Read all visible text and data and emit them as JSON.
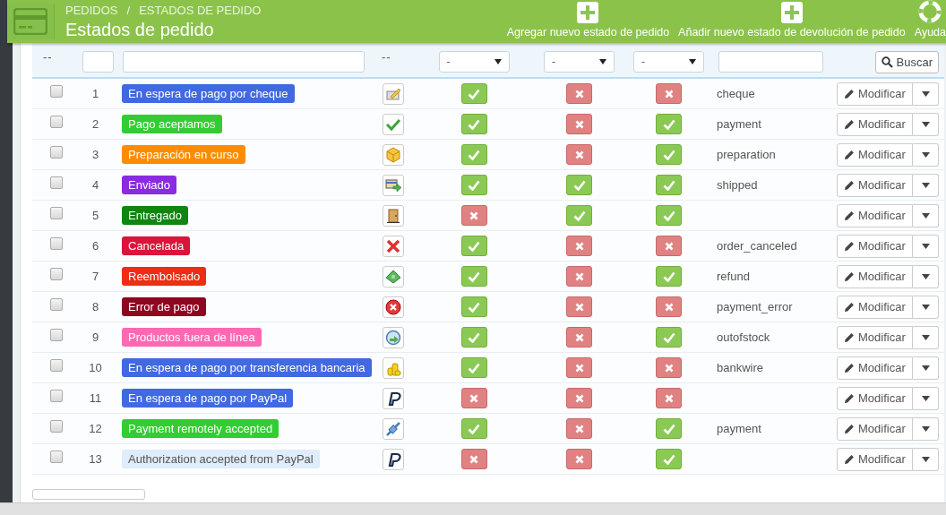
{
  "breadcrumb": [
    "PEDIDOS",
    "/",
    "ESTADOS DE PEDIDO"
  ],
  "title": "Estados de pedido",
  "toolbar": [
    {
      "label": "Agregar nuevo estado de pedido",
      "kind": "add"
    },
    {
      "label": "Añadir nuevo estado de devolución de pedido",
      "kind": "add"
    },
    {
      "label": "Ayuda",
      "kind": "help"
    }
  ],
  "filters": {
    "checkbox_column": "--",
    "icon_column": "--",
    "selects": [
      "-",
      "-",
      "-"
    ],
    "search_button": "Buscar"
  },
  "rows": [
    {
      "checked": false,
      "id": "1",
      "name": "En espera de pago por cheque",
      "color": "#4169e1",
      "flags": [
        {
          "on": true
        },
        {
          "on": false
        },
        {
          "on": false
        }
      ],
      "template": "cheque",
      "action": "Modificar"
    },
    {
      "checked": false,
      "id": "2",
      "name": "Pago aceptamos",
      "color": "#32cd32",
      "flags": [
        {
          "on": true
        },
        {
          "on": false
        },
        {
          "on": true
        }
      ],
      "template": "payment",
      "action": "Modificar"
    },
    {
      "checked": false,
      "id": "3",
      "name": "Preparación en curso",
      "color": "#ff8c00",
      "flags": [
        {
          "on": true
        },
        {
          "on": false
        },
        {
          "on": true
        }
      ],
      "template": "preparation",
      "action": "Modificar"
    },
    {
      "checked": false,
      "id": "4",
      "name": "Enviado",
      "color": "#8a2be2",
      "flags": [
        {
          "on": true
        },
        {
          "on": true
        },
        {
          "on": true
        }
      ],
      "template": "shipped",
      "action": "Modificar"
    },
    {
      "checked": false,
      "id": "5",
      "name": "Entregado",
      "color": "#108510",
      "flags": [
        {
          "on": false
        },
        {
          "on": true
        },
        {
          "on": true
        }
      ],
      "action": "Modificar"
    },
    {
      "checked": false,
      "id": "6",
      "name": "Cancelada",
      "color": "#dc143c",
      "flags": [
        {
          "on": true
        },
        {
          "on": false
        },
        {
          "on": false
        }
      ],
      "template": "order_canceled",
      "action": "Modificar"
    },
    {
      "checked": false,
      "id": "7",
      "name": "Reembolsado",
      "color": "#ec2e15",
      "flags": [
        {
          "on": true
        },
        {
          "on": false
        },
        {
          "on": true
        }
      ],
      "template": "refund",
      "action": "Modificar"
    },
    {
      "checked": false,
      "id": "8",
      "name": "Error de pago",
      "color": "#8f0621",
      "flags": [
        {
          "on": true
        },
        {
          "on": false
        },
        {
          "on": false
        }
      ],
      "template": "payment_error",
      "action": "Modificar"
    },
    {
      "checked": false,
      "id": "9",
      "name": "Productos fuera de línea",
      "color": "#ff69b4",
      "flags": [
        {
          "on": true
        },
        {
          "on": false
        },
        {
          "on": true
        }
      ],
      "template": "outofstock",
      "action": "Modificar"
    },
    {
      "checked": false,
      "id": "10",
      "name": "En espera de pago por transferencia bancaria",
      "color": "#4169e1",
      "flags": [
        {
          "on": true
        },
        {
          "on": false
        },
        {
          "on": false
        }
      ],
      "template": "bankwire",
      "action": "Modificar"
    },
    {
      "checked": false,
      "id": "11",
      "name": "En espera de pago por PayPal",
      "color": "#4169e1",
      "flags": [
        {
          "on": false
        },
        {
          "on": false
        },
        {
          "on": false
        }
      ],
      "action": "Modificar"
    },
    {
      "checked": false,
      "id": "12",
      "name": "Payment remotely accepted",
      "color": "#32cd32",
      "flags": [
        {
          "on": true
        },
        {
          "on": false
        },
        {
          "on": true
        }
      ],
      "template": "payment",
      "action": "Modificar"
    },
    {
      "checked": false,
      "id": "13",
      "name": "Authorization accepted from PayPal",
      "color": "#dfecfb",
      "flags": [
        {
          "on": false
        },
        {
          "on": false
        },
        {
          "on": true
        }
      ],
      "action": "Modificar"
    }
  ]
}
